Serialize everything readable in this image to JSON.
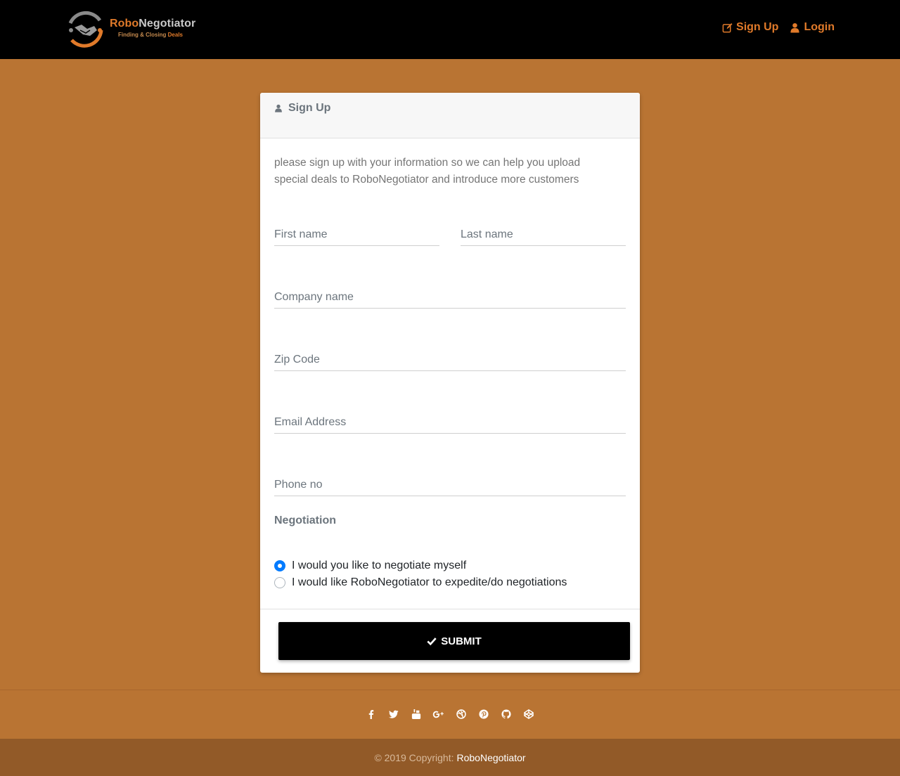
{
  "brand": {
    "name_part1": "Robo",
    "name_part2": "Negotiator",
    "tagline_part1": "Finding & Closing ",
    "tagline_part2": "Deals"
  },
  "nav": {
    "signup_label": "Sign Up",
    "login_label": "Login"
  },
  "card": {
    "header_title": "Sign Up",
    "intro": "please sign up with your information so we can help you upload special deals to RoboNegotiator and introduce more customers",
    "fields": {
      "first_name": "First name",
      "last_name": "Last name",
      "company": "Company name",
      "zip": "Zip Code",
      "email": "Email Address",
      "phone": "Phone no"
    },
    "negotiation_label": "Negotiation",
    "options": [
      {
        "label": "I would you like to negotiate myself",
        "checked": true
      },
      {
        "label": "I would like RoboNegotiator to expedite/do negotiations",
        "checked": false
      }
    ],
    "submit_label": "SUBMIT"
  },
  "footer": {
    "social": [
      "facebook-icon",
      "twitter-icon",
      "youtube-icon",
      "google-plus-icon",
      "dribbble-icon",
      "pinterest-icon",
      "github-icon",
      "codepen-icon"
    ],
    "copyright_prefix": "© 2019 Copyright:",
    "copyright_link": "RoboNegotiator"
  },
  "colors": {
    "accent": "#e07a2a",
    "background": "#b97433",
    "copybar": "#925a28",
    "radio_checked": "#007bff"
  }
}
